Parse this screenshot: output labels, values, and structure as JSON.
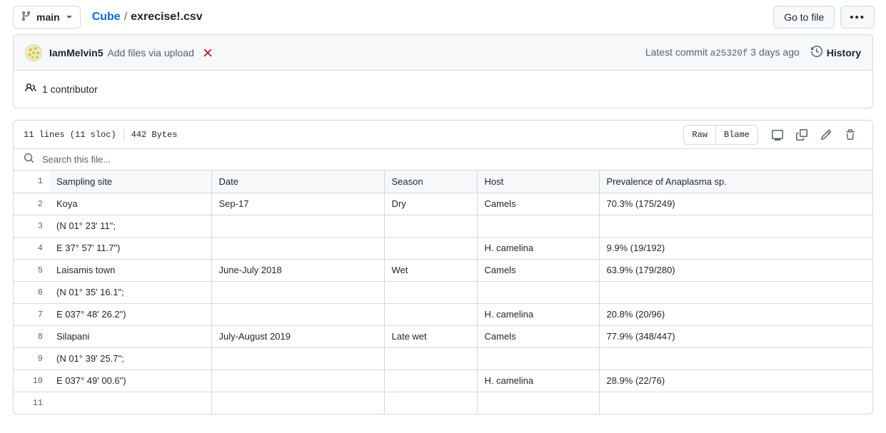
{
  "topbar": {
    "branch_icon": "git-branch-icon",
    "branch_name": "main",
    "repo_name": "Cube",
    "separator": "/",
    "file_name": "exrecise!.csv",
    "go_to_file_label": "Go to file",
    "kebab_label": "•••"
  },
  "commit": {
    "author": "IamMelvin5",
    "message": "Add files via upload",
    "status_icon": "x-failed-icon",
    "latest_commit_label": "Latest commit",
    "sha": "a25320f",
    "time_ago": "3 days ago",
    "history_icon": "history-clock-icon",
    "history_label": "History"
  },
  "contributors": {
    "icon": "people-icon",
    "count": "1",
    "label": "contributor",
    "text": "1 contributor"
  },
  "file_toolbar": {
    "lines_text": "11 lines (11 sloc)",
    "size_text": "442 Bytes",
    "raw_label": "Raw",
    "blame_label": "Blame",
    "icons": [
      "open-in-desktop-icon",
      "copy-icon",
      "edit-pencil-icon",
      "delete-trash-icon"
    ]
  },
  "search": {
    "icon": "search-icon",
    "placeholder": "Search this file...",
    "value": ""
  },
  "table": {
    "columns": [
      "Sampling site",
      "Date",
      "Season",
      "Host",
      "Prevalence of Anaplasma sp."
    ],
    "rows": [
      {
        "line": "1",
        "header": true,
        "cells": [
          "Sampling site",
          "Date",
          "Season",
          "Host",
          "Prevalence of Anaplasma sp."
        ]
      },
      {
        "line": "2",
        "header": false,
        "cells": [
          "Koya",
          "Sep-17",
          "Dry",
          "Camels",
          "70.3% (175/249)"
        ]
      },
      {
        "line": "3",
        "header": false,
        "cells": [
          "(N 01° 23' 11\";",
          "",
          "",
          "",
          ""
        ]
      },
      {
        "line": "4",
        "header": false,
        "cells": [
          "E 37° 57' 11.7\")",
          "",
          "",
          "H. camelina",
          "9.9% (19/192)"
        ]
      },
      {
        "line": "5",
        "header": false,
        "cells": [
          "Laisamis town",
          "June-July 2018",
          "Wet",
          "Camels",
          "63.9% (179/280)"
        ]
      },
      {
        "line": "6",
        "header": false,
        "cells": [
          "(N 01° 35' 16.1\";",
          "",
          "",
          "",
          ""
        ]
      },
      {
        "line": "7",
        "header": false,
        "cells": [
          "E 037° 48' 26.2\")",
          "",
          "",
          "H. camelina",
          "20.8% (20/96)"
        ]
      },
      {
        "line": "8",
        "header": false,
        "cells": [
          "Silapani",
          "July-August 2019",
          "Late wet",
          "Camels",
          "77.9% (348/447)"
        ]
      },
      {
        "line": "9",
        "header": false,
        "cells": [
          "(N 01° 39' 25.7\";",
          "",
          "",
          "",
          ""
        ]
      },
      {
        "line": "10",
        "header": false,
        "cells": [
          "E 037° 49' 00.6\")",
          "",
          "",
          "H. camelina",
          "28.9% (22/76)"
        ]
      },
      {
        "line": "11",
        "header": false,
        "cells": [
          "",
          "",
          "",
          "",
          ""
        ]
      }
    ]
  },
  "colors": {
    "link": "#0969da",
    "border": "#d1d9e0",
    "muted": "#59636e",
    "header_bg": "#f6f8fa",
    "danger": "#cf222e"
  }
}
